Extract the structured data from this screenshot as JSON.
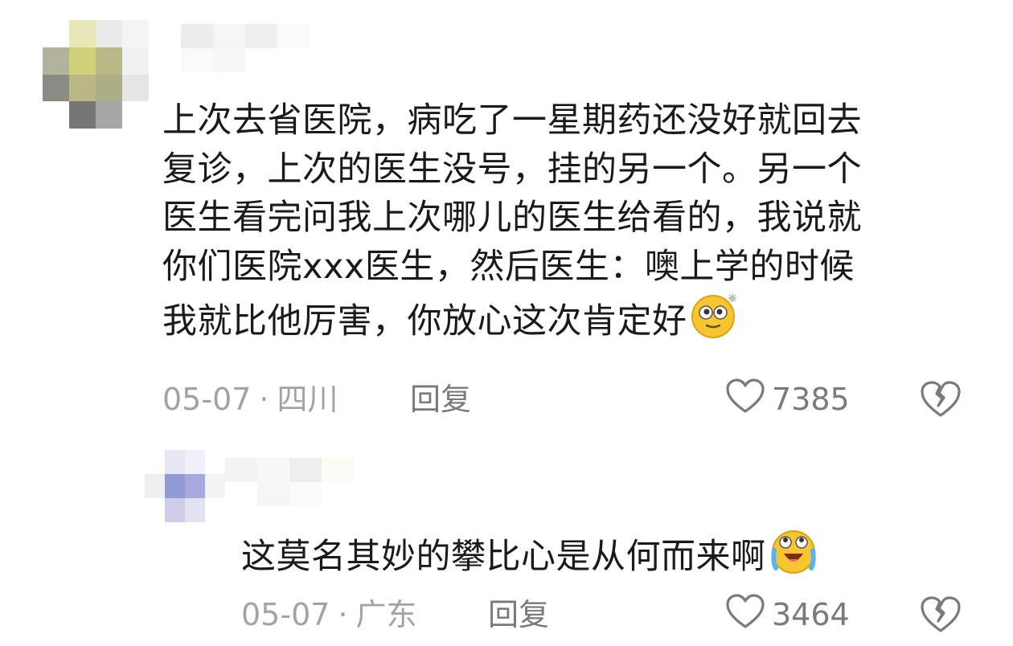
{
  "comments": [
    {
      "text_lines": [
        "上次去省医院，病吃了一星期药还没好就回去",
        "复诊，上次的医生没号，挂的另一个。另一个",
        "医生看完问我上次哪儿的医生给看的，我说就",
        "你们医院xxx医生，然后医生：噢上学的时候",
        "我就比他厉害，你放心这次肯定好"
      ],
      "emoji": "dizzy-face-emoji",
      "date": "05-07",
      "separator": "·",
      "location": "四川",
      "reply_label": "回复",
      "like_count": "7385"
    },
    {
      "text_lines": [
        "这莫名其妙的攀比心是从何而来啊"
      ],
      "emoji": "crying-face-emoji",
      "date": "05-07",
      "separator": "·",
      "location": "广东",
      "reply_label": "回复",
      "like_count": "3464"
    }
  ],
  "colors": {
    "text": "#1a1a1a",
    "meta": "#a3a3a3",
    "action": "#7a7a7a",
    "emoji_yellow": "#f7c62f"
  }
}
